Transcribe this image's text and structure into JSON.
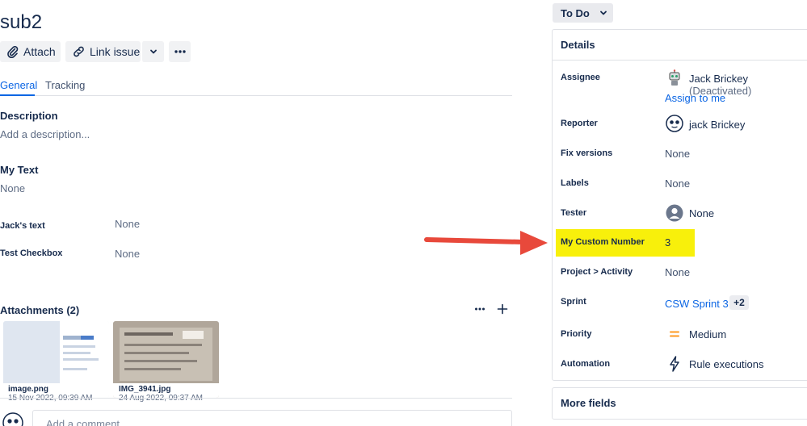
{
  "issue": {
    "title": "sub2"
  },
  "toolbar": {
    "attach_label": "Attach",
    "link_issue_label": "Link issue"
  },
  "tabs": [
    {
      "label": "General"
    },
    {
      "label": "Tracking"
    }
  ],
  "fields": {
    "description": {
      "label": "Description",
      "placeholder": "Add a description..."
    },
    "my_text": {
      "label": "My Text",
      "value": "None"
    },
    "jacks_text": {
      "label": "Jack's text",
      "value": "None"
    },
    "test_checkbox": {
      "label": "Test Checkbox",
      "value": "None"
    }
  },
  "attachments": {
    "title": "Attachments (2)",
    "items": [
      {
        "name": "image.png",
        "date": "15 Nov 2022, 09:39 AM"
      },
      {
        "name": "IMG_3941.jpg",
        "date": "24 Aug 2022, 09:37 AM"
      }
    ]
  },
  "comment": {
    "placeholder": "Add a comment..."
  },
  "status": {
    "label": "To Do"
  },
  "details": {
    "title": "Details",
    "assignee": {
      "label": "Assignee",
      "name": "Jack Brickey",
      "note": "(Deactivated)",
      "assign_link": "Assign to me"
    },
    "reporter": {
      "label": "Reporter",
      "name": "jack Brickey"
    },
    "fix_versions": {
      "label": "Fix versions",
      "value": "None"
    },
    "labels": {
      "label": "Labels",
      "value": "None"
    },
    "tester": {
      "label": "Tester",
      "value": "None"
    },
    "custom_number": {
      "label": "My Custom Number",
      "value": "3"
    },
    "project_activity": {
      "label": "Project > Activity",
      "value": "None"
    },
    "sprint": {
      "label": "Sprint",
      "value": "CSW Sprint 3",
      "extra": "+2"
    },
    "priority": {
      "label": "Priority",
      "value": "Medium"
    },
    "automation": {
      "label": "Automation",
      "value": "Rule executions"
    }
  },
  "more_fields": {
    "title": "More fields"
  },
  "colors": {
    "highlight": "#f8f00b",
    "arrow": "#e8493b",
    "link": "#0c66e4",
    "priority": "#ff991f"
  }
}
